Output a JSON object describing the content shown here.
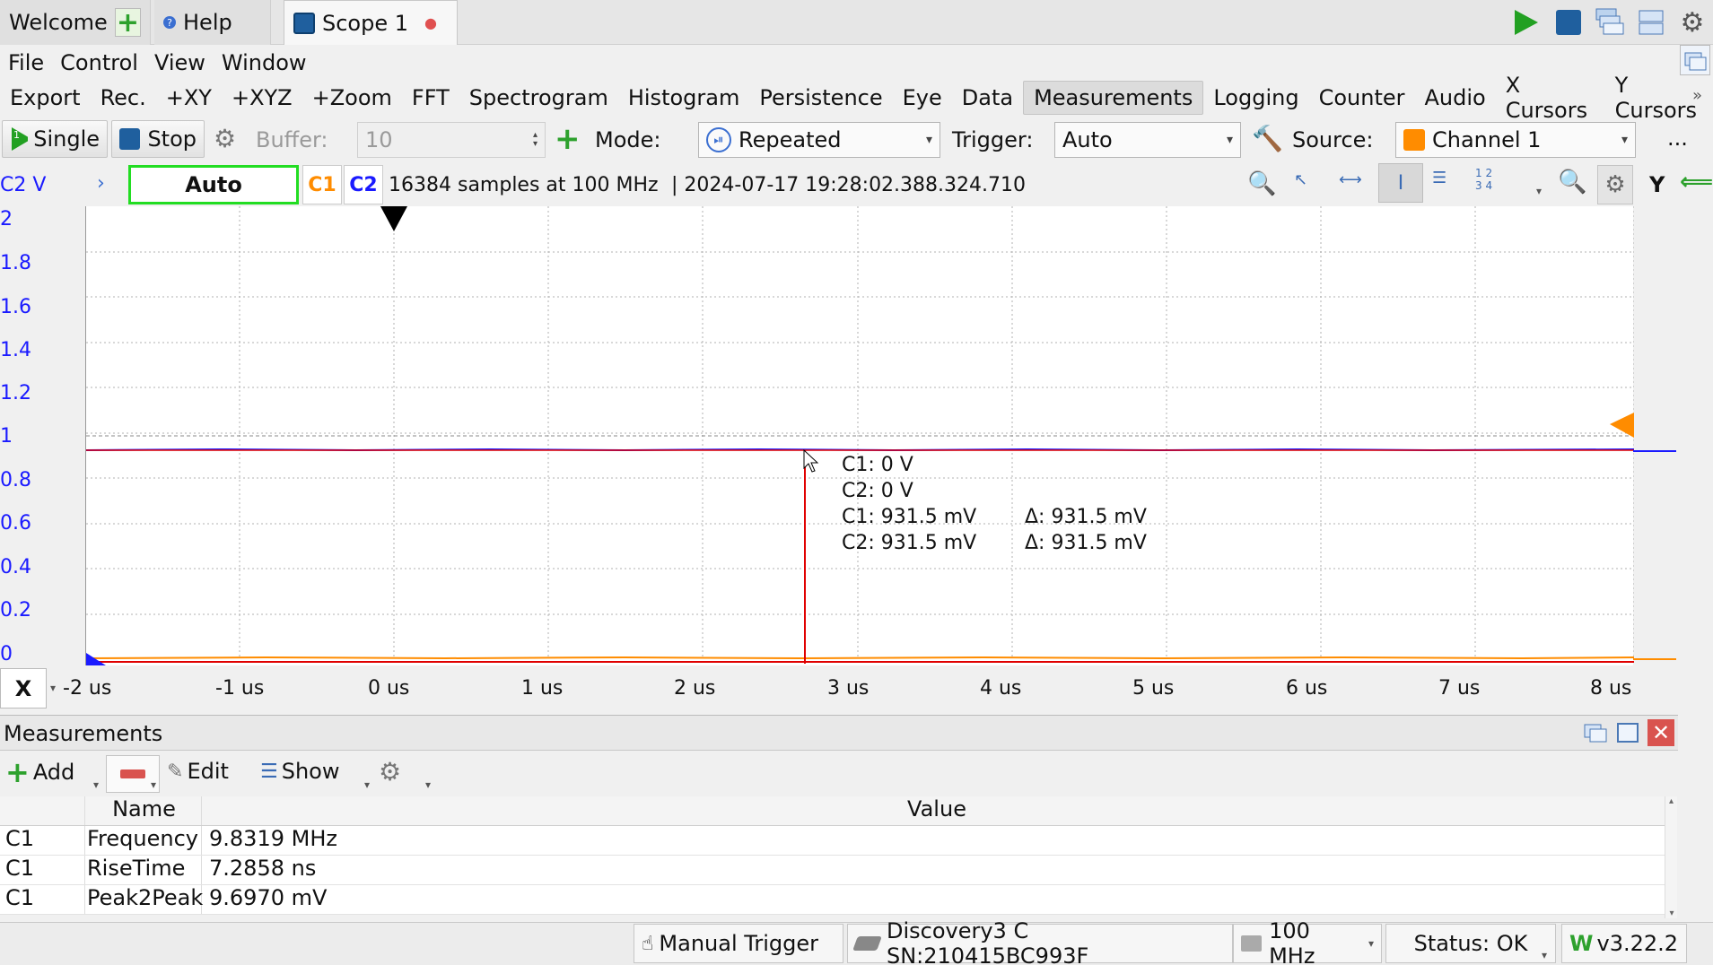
{
  "tabs": [
    {
      "label": "Welcome"
    },
    {
      "label": "Help"
    },
    {
      "label": "Scope 1"
    }
  ],
  "menu": [
    "File",
    "Control",
    "View",
    "Window"
  ],
  "views": [
    "Export",
    "Rec.",
    "+XY",
    "+XYZ",
    "+Zoom",
    "FFT",
    "Spectrogram",
    "Histogram",
    "Persistence",
    "Eye",
    "Data",
    "Measurements",
    "Logging",
    "Counter",
    "Audio",
    "X Cursors",
    "Y Cursors"
  ],
  "views_selected": "Measurements",
  "acq": {
    "single": "Single",
    "stop": "Stop",
    "buffer_label": "Buffer:",
    "buffer_value": "10",
    "mode_label": "Mode:",
    "mode_value": "Repeated",
    "trigger_label": "Trigger:",
    "trigger_value": "Auto",
    "source_label": "Source:",
    "source_value": "Channel 1",
    "more": "..."
  },
  "info": {
    "channel_unit": "C2 V",
    "auto_status": "Auto",
    "c1": "C1",
    "c2": "C2",
    "samples": "16384 samples at 100 MHz",
    "timestamp": "| 2024-07-17 19:28:02.388.324.710",
    "y_label": "Y",
    "numbers_icon": "1 2\n3 4"
  },
  "plot": {
    "y_ticks": [
      "2",
      "1.8",
      "1.6",
      "1.4",
      "1.2",
      "1",
      "0.8",
      "0.6",
      "0.4",
      "0.2",
      "0"
    ],
    "x_label": "X",
    "x_ticks": [
      "-2 us",
      "-1 us",
      "0 us",
      "1 us",
      "2 us",
      "3 us",
      "4 us",
      "5 us",
      "6 us",
      "7 us",
      "8 us"
    ],
    "cursor_readout": [
      "C1: 0 V",
      "C2: 0 V",
      "C1: 931.5 mV",
      "C2: 931.5 mV"
    ],
    "delta_readout": [
      "Δ: 931.5 mV",
      "Δ: 931.5 mV"
    ],
    "colors": {
      "c1": "#ff8c00",
      "c2": "#1a1aff",
      "cursor": "#e00000",
      "grid": "#b0b0b0"
    }
  },
  "measurements": {
    "title": "Measurements",
    "add": "Add",
    "edit": "Edit",
    "show": "Show",
    "columns": [
      "",
      "Name",
      "Value"
    ],
    "rows": [
      [
        "C1",
        "Frequency",
        "9.8319 MHz"
      ],
      [
        "C1",
        "RiseTime",
        "7.2858 ns"
      ],
      [
        "C1",
        "Peak2Peak",
        "9.6970 mV"
      ]
    ]
  },
  "status": {
    "manual_trigger": "Manual Trigger",
    "device": "Discovery3 C SN:210415BC993F",
    "clock": "100 MHz",
    "status": "Status: OK",
    "version": "v3.22.2"
  }
}
